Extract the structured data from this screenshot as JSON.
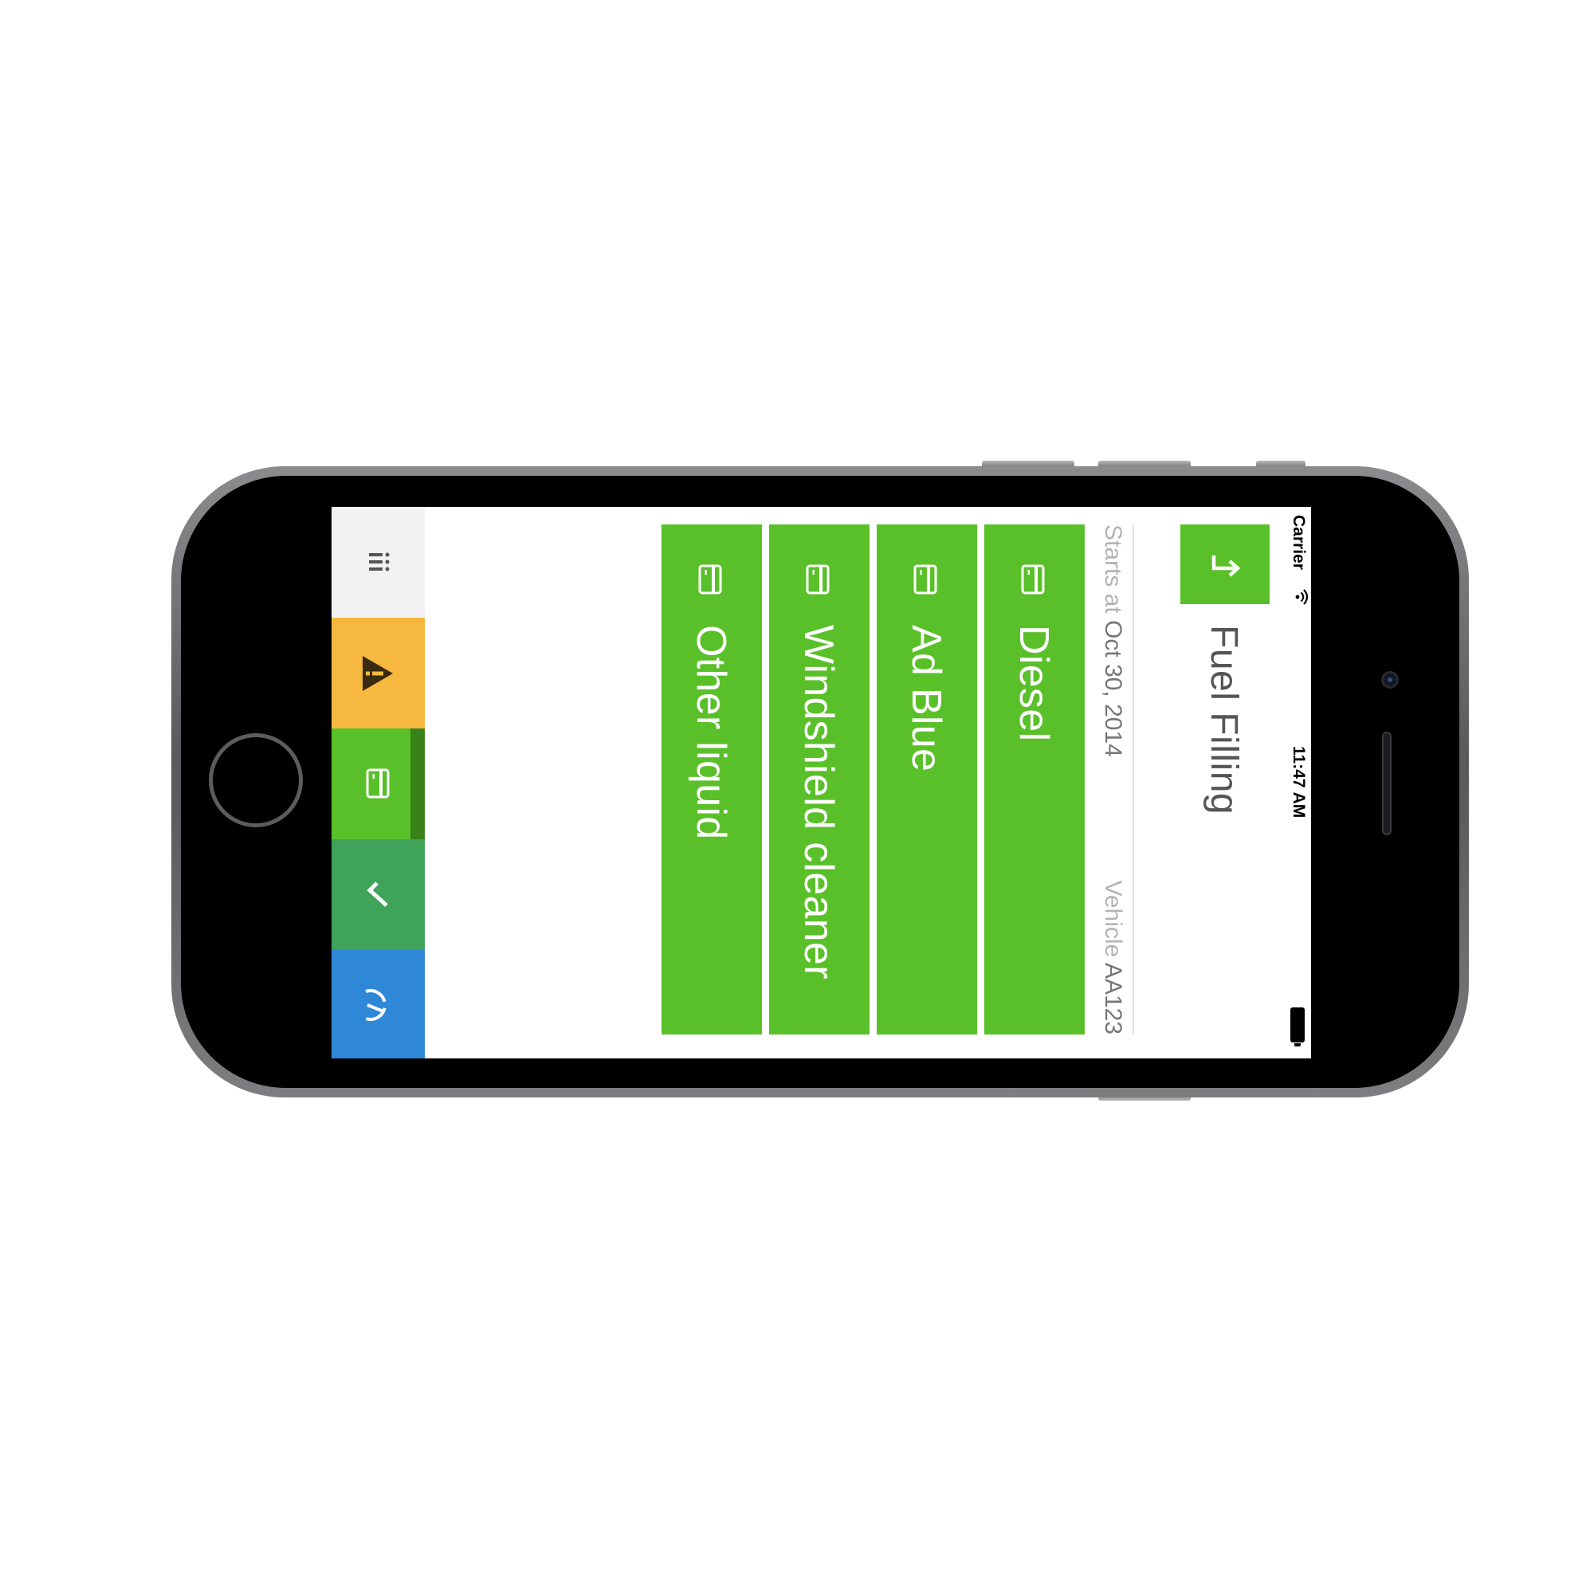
{
  "status_bar": {
    "carrier": "Carrier",
    "time": "11:47 AM"
  },
  "header": {
    "title": "Fuel Filling",
    "back_icon": "return-arrow-icon"
  },
  "meta": {
    "starts_label": "Starts at",
    "starts_value": "Oct 30, 2014",
    "vehicle_label": "Vehicle",
    "vehicle_value": "AA123"
  },
  "options": [
    {
      "label": "Diesel",
      "icon": "card-icon"
    },
    {
      "label": "Ad Blue",
      "icon": "card-icon"
    },
    {
      "label": "Windshield cleaner",
      "icon": "card-icon"
    },
    {
      "label": "Other liquid",
      "icon": "card-icon"
    }
  ],
  "tabbar": {
    "tabs": [
      {
        "icon": "menu-icon",
        "color": "#f2f2f2"
      },
      {
        "icon": "warning-icon",
        "color": "#f6b83e"
      },
      {
        "icon": "card-icon",
        "color": "#5ac02a",
        "active": true
      },
      {
        "icon": "checkmark-icon",
        "color": "#3fa35a"
      },
      {
        "icon": "speedometer-icon",
        "color": "#2f87d8"
      }
    ]
  },
  "colors": {
    "accent_green": "#5ac02a",
    "warning_yellow": "#f6b83e",
    "check_green": "#3fa35a",
    "blue": "#2f87d8"
  }
}
